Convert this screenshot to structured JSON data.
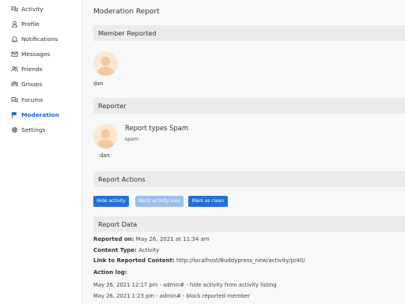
{
  "sidebar": {
    "items": [
      {
        "label": "Activity",
        "icon": "chat-bubbles-icon"
      },
      {
        "label": "Profile",
        "icon": "user-icon"
      },
      {
        "label": "Notifications",
        "icon": "bell-icon"
      },
      {
        "label": "Messages",
        "icon": "envelope-icon"
      },
      {
        "label": "Friends",
        "icon": "users-icon"
      },
      {
        "label": "Groups",
        "icon": "group-icon"
      },
      {
        "label": "Forums",
        "icon": "forum-bubbles-icon"
      },
      {
        "label": "Moderation",
        "icon": "flag-icon",
        "active": true
      },
      {
        "label": "Settings",
        "icon": "gear-icon"
      }
    ],
    "active_color": "#1e63cc"
  },
  "page": {
    "title": "Moderation Report",
    "member_reported": {
      "heading": "Member Reported",
      "name": "dan"
    },
    "reporter": {
      "heading": "Reporter",
      "name": "dan",
      "report_type": "Report types Spam",
      "report_sub": "spam"
    },
    "actions": {
      "heading": "Report Actions",
      "buttons": [
        {
          "label": "Hide activity",
          "state": "enabled"
        },
        {
          "label": "Block activity user",
          "state": "disabled"
        },
        {
          "label": "Mark as clean",
          "state": "enabled"
        }
      ]
    },
    "report_data": {
      "heading": "Report Data",
      "reported_on_label": "Reported on:",
      "reported_on_value": "May 26, 2021 at 11:34 am",
      "content_type_label": "Content Type:",
      "content_type_value": "Activity",
      "link_label": "Link to Reported Content:",
      "link_value": "http://localhost/Buddypress_new/activity/p/40/",
      "action_log_label": "Action log:",
      "log": [
        "May 26, 2021 12:17 pm - admin# - hide activity from activity listing",
        "May 26, 2021 1:23 pm - admin# - block reported member"
      ]
    }
  },
  "colors": {
    "primary_button": "#2271d6",
    "disabled_button": "#9ac0ee",
    "section_bar": "#eaebed",
    "avatar_bg": "#fae8d4"
  }
}
